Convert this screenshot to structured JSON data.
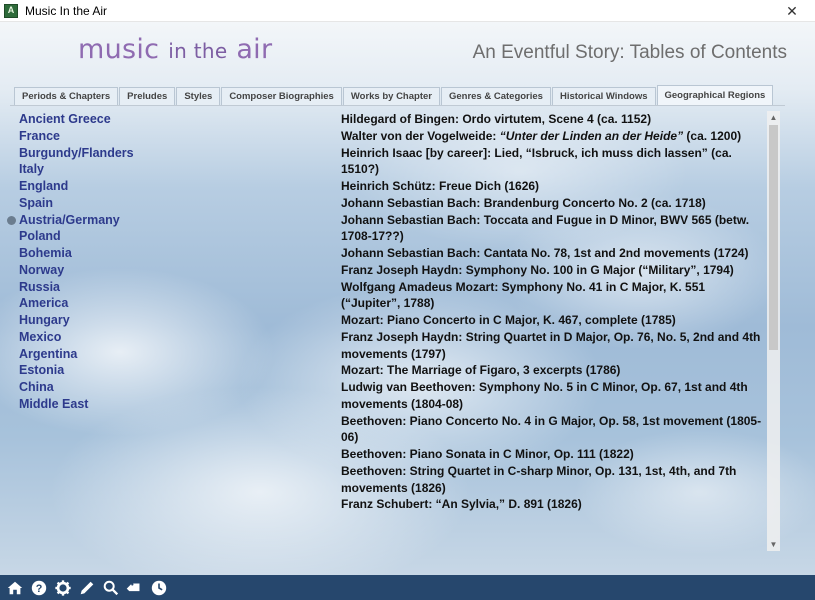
{
  "window": {
    "title": "Music In the Air",
    "app_icon_letter": "A",
    "close_glyph": "✕"
  },
  "header": {
    "logo_part1": "music",
    "logo_part2": "in the",
    "logo_part3": "air",
    "page_title": "An Eventful Story: Tables of Contents"
  },
  "tabs": [
    "Periods & Chapters",
    "Preludes",
    "Styles",
    "Composer Biographies",
    "Works by Chapter",
    "Genres & Categories",
    "Historical Windows",
    "Geographical Regions"
  ],
  "active_tab": "Geographical Regions",
  "regions": [
    "Ancient Greece",
    "France",
    "Burgundy/Flanders",
    "Italy",
    "England",
    "Spain",
    "Austria/Germany",
    "Poland",
    "Bohemia",
    "Norway",
    "Russia",
    "America",
    "Hungary",
    "Mexico",
    "Argentina",
    "Estonia",
    "China",
    "Middle East"
  ],
  "selected_region": "Austria/Germany",
  "works": [
    {
      "text": "Hildegard of Bingen: Ordo virtutem, Scene 4 (ca. 1152)"
    },
    {
      "text": "Walter von der Vogelweide: ",
      "quote": "“Unter der Linden an der Heide”",
      "after": " (ca. 1200)"
    },
    {
      "text": "Heinrich Isaac [by career]: Lied, “Isbruck, ich muss dich lassen” (ca. 1510?)"
    },
    {
      "text": "Heinrich Schütz: Freue Dich (1626)"
    },
    {
      "text": "Johann Sebastian Bach: Brandenburg Concerto No. 2 (ca. 1718)"
    },
    {
      "text": "Johann Sebastian Bach: Toccata and Fugue in D Minor, BWV 565 (betw. 1708-17??)"
    },
    {
      "text": "Johann Sebastian Bach: Cantata No. 78, 1st and 2nd movements (1724)"
    },
    {
      "text": "Franz Joseph Haydn: Symphony No. 100 in G Major (“Military”, 1794)"
    },
    {
      "text": "Wolfgang Amadeus Mozart: Symphony No. 41 in C Major, K. 551 (“Jupiter”, 1788)"
    },
    {
      "text": "Mozart: Piano Concerto in C Major, K. 467, complete (1785)"
    },
    {
      "text": "Franz Joseph Haydn: String Quartet in D Major, Op. 76, No. 5, 2nd and 4th movements (1797)"
    },
    {
      "text": "Mozart: The Marriage of Figaro, 3 excerpts (1786)"
    },
    {
      "text": "Ludwig van Beethoven: Symphony No. 5 in C Minor, Op. 67, 1st and 4th movements (1804-08)"
    },
    {
      "text": "Beethoven: Piano Concerto No. 4 in G Major, Op. 58, 1st movement (1805-06)"
    },
    {
      "text": "Beethoven: Piano Sonata in C Minor, Op. 111 (1822)"
    },
    {
      "text": "Beethoven: String Quartet in C-sharp Minor, Op. 131, 1st, 4th, and 7th movements (1826)"
    },
    {
      "text": "Franz Schubert: “An Sylvia,” D. 891  (1826)"
    }
  ],
  "scrollbar": {
    "up_glyph": "▲",
    "down_glyph": "▼"
  },
  "toolbar": [
    {
      "name": "home-icon"
    },
    {
      "name": "help-icon"
    },
    {
      "name": "settings-icon"
    },
    {
      "name": "pencil-icon"
    },
    {
      "name": "search-icon"
    },
    {
      "name": "bookmark-icon"
    },
    {
      "name": "clock-icon"
    }
  ],
  "colors": {
    "region_text": "#2d3a8c",
    "toolbar_bg": "#26476d",
    "logo": "#8f6bb1"
  }
}
